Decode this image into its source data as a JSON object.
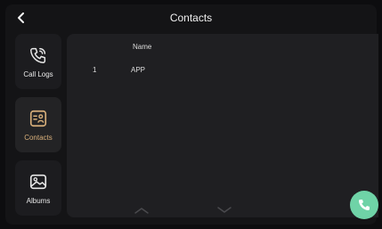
{
  "header": {
    "title": "Contacts"
  },
  "nav": {
    "items": [
      {
        "label": "Call Logs",
        "icon": "phone-icon"
      },
      {
        "label": "Contacts",
        "icon": "contact-card-icon",
        "active": true
      },
      {
        "label": "Albums",
        "icon": "image-icon"
      }
    ]
  },
  "table": {
    "columns": [
      "",
      "Name"
    ],
    "rows": [
      {
        "index": "1",
        "name": "APP"
      }
    ]
  },
  "colors": {
    "accent": "#d9b07b",
    "call": "#6fd3a7"
  }
}
